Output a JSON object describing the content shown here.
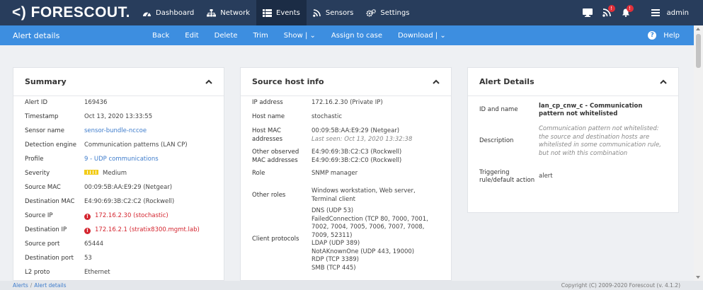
{
  "brand": {
    "logo": "<) FORESCOUT."
  },
  "nav": {
    "items": [
      {
        "label": "Dashboard",
        "icon": "gauge-icon"
      },
      {
        "label": "Network",
        "icon": "network-icon"
      },
      {
        "label": "Events",
        "icon": "list-icon",
        "active": true
      },
      {
        "label": "Sensors",
        "icon": "signal-icon"
      },
      {
        "label": "Settings",
        "icon": "gears-icon"
      }
    ],
    "user": "admin",
    "badges": {
      "sensors": "!",
      "notifications": "!"
    }
  },
  "actionbar": {
    "title": "Alert details",
    "buttons": [
      "Back",
      "Edit",
      "Delete",
      "Trim",
      "Show | ⌄",
      "Assign to case",
      "Download | ⌄"
    ],
    "help": "Help"
  },
  "summary": {
    "title": "Summary",
    "rows": [
      {
        "label": "Alert ID",
        "value": "169436"
      },
      {
        "label": "Timestamp",
        "value": "Oct 13, 2020 13:33:55"
      },
      {
        "label": "Sensor name",
        "value": "sensor-bundle-nccoe"
      },
      {
        "label": "Detection engine",
        "value": "Communication patterns (LAN CP)"
      },
      {
        "label": "Profile",
        "value": "9 - UDP communications"
      },
      {
        "label": "Severity",
        "value": "Medium"
      },
      {
        "label": "Source MAC",
        "value": "00:09:5B:AA:E9:29 (Netgear)"
      },
      {
        "label": "Destination MAC",
        "value": "E4:90:69:3B:C2:C2 (Rockwell)"
      },
      {
        "label": "Source IP",
        "value": "172.16.2.30 (stochastic)"
      },
      {
        "label": "Destination IP",
        "value": "172.16.2.1 (stratix8300.mgmt.lab)"
      },
      {
        "label": "Source port",
        "value": "65444"
      },
      {
        "label": "Destination port",
        "value": "53"
      },
      {
        "label": "L2 proto",
        "value": "Ethernet"
      }
    ]
  },
  "source_host": {
    "title": "Source host info",
    "ip_label": "IP address",
    "ip_value": "172.16.2.30 (Private IP)",
    "hostname_label": "Host name",
    "hostname_value": "stochastic",
    "mac_label": "Host MAC addresses",
    "mac_value": "00:09:5B:AA:E9:29 (Netgear)",
    "mac_seen": "Last seen: Oct 13, 2020 13:32:38",
    "other_mac_label": "Other observed MAC addresses",
    "other_mac_1": "E4:90:69:3B:C2:C3 (Rockwell)",
    "other_mac_2": "E4:90:69:3B:C2:C0 (Rockwell)",
    "role_label": "Role",
    "role_value": "SNMP manager",
    "other_roles_label": "Other roles",
    "other_roles_value": "Windows workstation, Web server, Terminal client",
    "client_protocols_label": "Client protocols",
    "client_protocols": [
      "DNS (UDP 53)",
      "FailedConnection (TCP 80, 7000, 7001, 7002, 7004, 7005, 7006, 7007, 7008, 7009, 52311)",
      "LDAP (UDP 389)",
      "NotAKnownOne (UDP 443, 19000)",
      "RDP (TCP 3389)",
      "SMB (TCP 445)"
    ]
  },
  "alert_details": {
    "title": "Alert Details",
    "id_label": "ID and name",
    "id_value": "lan_cp_cnw_c - Communication pattern not whitelisted",
    "desc_label": "Description",
    "desc_value": "Communication pattern not whitelisted: the source and destination hosts are whitelisted in some communication rule, but not with this combination",
    "trigger_label": "Triggering rule/default action",
    "trigger_value": "alert"
  },
  "footer": {
    "crumb_1": "Alerts",
    "crumb_sep": "/",
    "crumb_2": "Alert details",
    "copyright": "Copyright (C) 2009-2020 Forescout (v. 4.1.2)"
  },
  "colors": {
    "nav_bg": "#283d5c",
    "action_bg": "#3d8ee0",
    "link": "#3f7dcc",
    "alert_red": "#d4252f",
    "severity_medium": "#f2cc1a"
  }
}
